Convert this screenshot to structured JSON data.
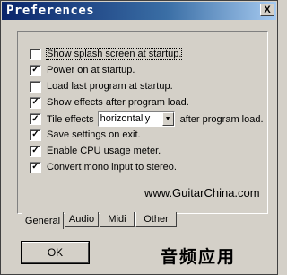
{
  "window": {
    "title": "Preferences",
    "close_glyph": "X"
  },
  "options": [
    {
      "label": "Show splash screen at startup.",
      "checked": false
    },
    {
      "label": "Power on at startup.",
      "checked": true
    },
    {
      "label": "Load last program at startup.",
      "checked": false
    },
    {
      "label": "Show effects after program load.",
      "checked": true
    },
    {
      "label": "Tile effects",
      "checked": true
    },
    {
      "label": "Save settings on exit.",
      "checked": true
    },
    {
      "label": "Enable CPU usage meter.",
      "checked": true
    },
    {
      "label": "Convert mono input to stereo.",
      "checked": true
    }
  ],
  "tile": {
    "select_value": "horizontally",
    "suffix": "after program load."
  },
  "watermark": "www.GuitarChina.com",
  "tabs": [
    {
      "label": "General",
      "active": true
    },
    {
      "label": "Audio",
      "active": false
    },
    {
      "label": "Midi",
      "active": false
    },
    {
      "label": "Other",
      "active": false
    }
  ],
  "ok_label": "OK",
  "logo_text": "音频应用",
  "icons": {
    "check": "✓",
    "dropdown": "▼"
  }
}
